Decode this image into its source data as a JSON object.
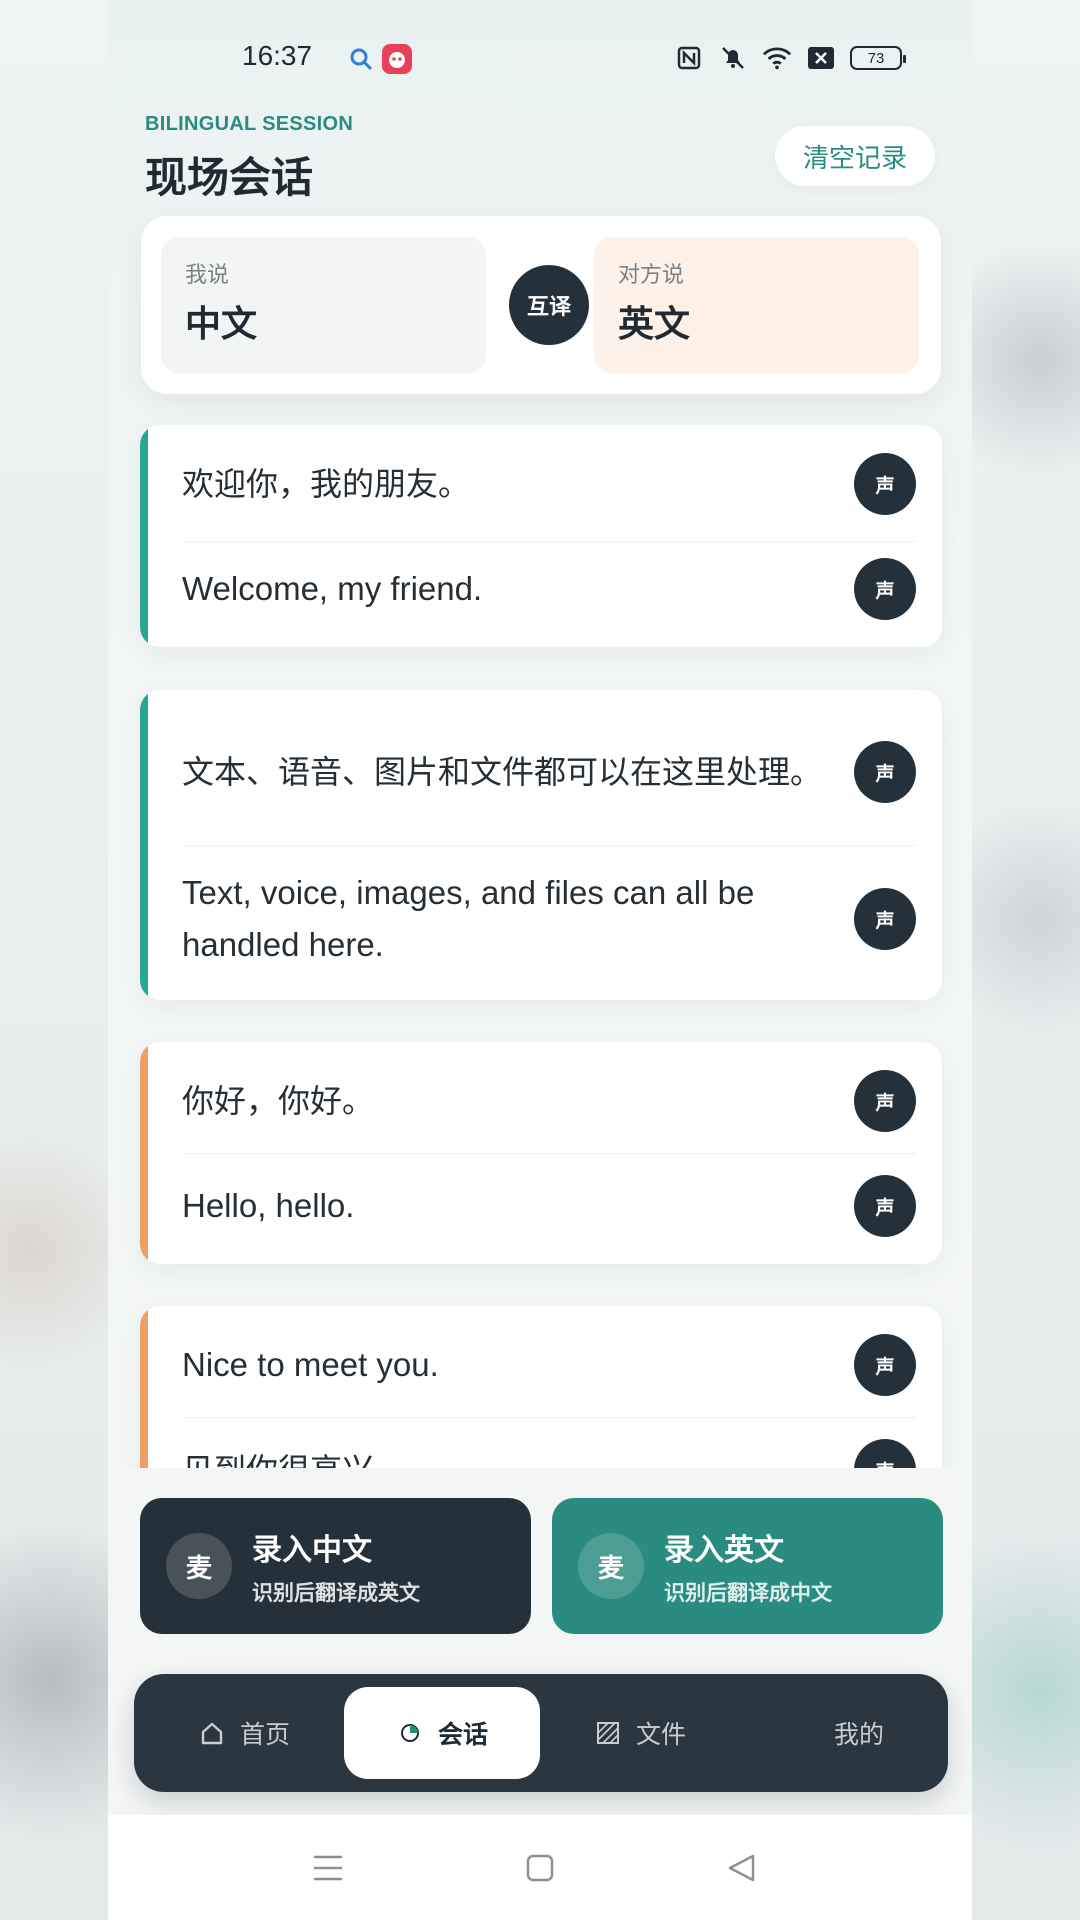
{
  "status_bar": {
    "time": "16:37",
    "battery": "73",
    "icons": [
      "search-icon",
      "app-icon",
      "nfc-icon",
      "mute-icon",
      "wifi-icon",
      "close-box-icon",
      "battery-icon"
    ]
  },
  "header": {
    "eyebrow": "BILINGUAL SESSION",
    "title": "现场会话",
    "clear_button": "清空记录"
  },
  "languages": {
    "mine_caption": "我说",
    "mine_value": "中文",
    "swap_label": "互译",
    "theirs_caption": "对方说",
    "theirs_value": "英文"
  },
  "speak_label": "声",
  "messages": [
    {
      "speaker": "mine",
      "source": "欢迎你，我的朋友。",
      "translation": "Welcome, my friend."
    },
    {
      "speaker": "mine",
      "source": "文本、语音、图片和文件都可以在这里处理。",
      "translation": "Text, voice, images, and files can all be handled here."
    },
    {
      "speaker": "theirs",
      "source": "你好，你好。",
      "translation": "Hello, hello."
    },
    {
      "speaker": "theirs",
      "source": "Nice to meet you.",
      "translation": "见到你很高兴。"
    }
  ],
  "input": {
    "mic_label": "麦",
    "zh_title": "录入中文",
    "zh_sub": "识别后翻译成英文",
    "en_title": "录入英文",
    "en_sub": "识别后翻译成中文"
  },
  "nav": {
    "items": [
      {
        "label": "首页",
        "icon": "home-icon"
      },
      {
        "label": "会话",
        "icon": "conversation-icon",
        "active": true
      },
      {
        "label": "文件",
        "icon": "file-icon"
      },
      {
        "label": "我的",
        "icon": "profile-icon"
      }
    ]
  },
  "colors": {
    "accent": "#2a8c80",
    "dark": "#24313a",
    "mine_accent": "#2aa593",
    "theirs_accent": "#eaa066"
  }
}
